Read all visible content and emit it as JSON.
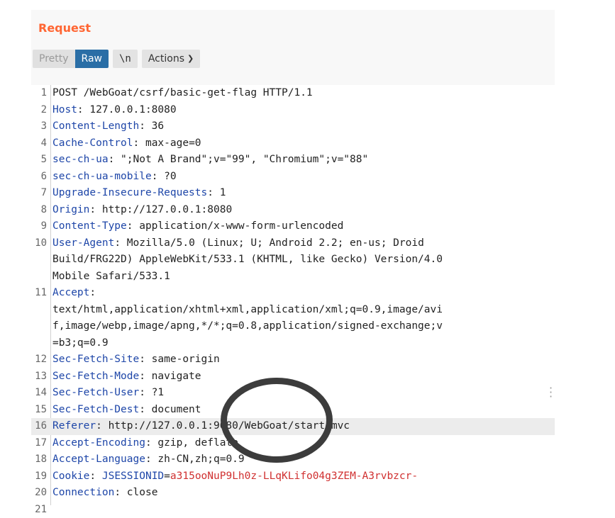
{
  "panel": {
    "title": "Request"
  },
  "toolbar": {
    "pretty_label": "Pretty",
    "raw_label": "Raw",
    "newline_label": "\\n",
    "actions_label": "Actions"
  },
  "lines": [
    {
      "n": "1",
      "segs": [
        {
          "t": "POST /WebGoat/csrf/basic-get-flag HTTP/1.1",
          "c": ""
        }
      ]
    },
    {
      "n": "2",
      "segs": [
        {
          "t": "Host",
          "c": "hk"
        },
        {
          "t": ": 127.0.0.1:8080",
          "c": ""
        }
      ]
    },
    {
      "n": "3",
      "segs": [
        {
          "t": "Content-Length",
          "c": "hk"
        },
        {
          "t": ": 36",
          "c": ""
        }
      ]
    },
    {
      "n": "4",
      "segs": [
        {
          "t": "Cache-Control",
          "c": "hk"
        },
        {
          "t": ": max-age=0",
          "c": ""
        }
      ]
    },
    {
      "n": "5",
      "segs": [
        {
          "t": "sec-ch-ua",
          "c": "hk"
        },
        {
          "t": ": \";Not A Brand\";v=\"99\", \"Chromium\";v=\"88\"",
          "c": ""
        }
      ]
    },
    {
      "n": "6",
      "segs": [
        {
          "t": "sec-ch-ua-mobile",
          "c": "hk"
        },
        {
          "t": ": ?0",
          "c": ""
        }
      ]
    },
    {
      "n": "7",
      "segs": [
        {
          "t": "Upgrade-Insecure-Requests",
          "c": "hk"
        },
        {
          "t": ": 1",
          "c": ""
        }
      ]
    },
    {
      "n": "8",
      "segs": [
        {
          "t": "Origin",
          "c": "hk"
        },
        {
          "t": ": http://127.0.0.1:8080",
          "c": ""
        }
      ]
    },
    {
      "n": "9",
      "segs": [
        {
          "t": "Content-Type",
          "c": "hk"
        },
        {
          "t": ": application/x-www-form-urlencoded",
          "c": ""
        }
      ]
    },
    {
      "n": "10",
      "segs": [
        {
          "t": "User-Agent",
          "c": "hk"
        },
        {
          "t": ": Mozilla/5.0 (Linux; U; Android 2.2; en-us; Droid",
          "c": ""
        }
      ]
    },
    {
      "n": "",
      "segs": [
        {
          "t": "Build/FRG22D) AppleWebKit/533.1 (KHTML, like Gecko) Version/4.0",
          "c": ""
        }
      ]
    },
    {
      "n": "",
      "segs": [
        {
          "t": "Mobile Safari/533.1",
          "c": ""
        }
      ]
    },
    {
      "n": "11",
      "segs": [
        {
          "t": "Accept",
          "c": "hk"
        },
        {
          "t": ":",
          "c": ""
        }
      ]
    },
    {
      "n": "",
      "segs": [
        {
          "t": "text/html,application/xhtml+xml,application/xml;q=0.9,image/avi",
          "c": ""
        }
      ]
    },
    {
      "n": "",
      "segs": [
        {
          "t": "f,image/webp,image/apng,*/*;q=0.8,application/signed-exchange;v",
          "c": ""
        }
      ]
    },
    {
      "n": "",
      "segs": [
        {
          "t": "=b3;q=0.9",
          "c": ""
        }
      ]
    },
    {
      "n": "12",
      "segs": [
        {
          "t": "Sec-Fetch-Site",
          "c": "hk"
        },
        {
          "t": ": same-origin",
          "c": ""
        }
      ]
    },
    {
      "n": "13",
      "segs": [
        {
          "t": "Sec-Fetch-Mode",
          "c": "hk"
        },
        {
          "t": ": navigate",
          "c": ""
        }
      ]
    },
    {
      "n": "14",
      "segs": [
        {
          "t": "Sec-Fetch-User",
          "c": "hk"
        },
        {
          "t": ": ?1",
          "c": ""
        }
      ]
    },
    {
      "n": "15",
      "segs": [
        {
          "t": "Sec-Fetch-Dest",
          "c": "hk"
        },
        {
          "t": ": document",
          "c": ""
        }
      ]
    },
    {
      "n": "16",
      "segs": [
        {
          "t": "Referer",
          "c": "hk"
        },
        {
          "t": ": http://127.0.0.1:9080/WebGoat/start.mvc",
          "c": ""
        }
      ],
      "highlight": true
    },
    {
      "n": "17",
      "segs": [
        {
          "t": "Accept-Encoding",
          "c": "hk"
        },
        {
          "t": ": gzip, deflate",
          "c": ""
        }
      ]
    },
    {
      "n": "18",
      "segs": [
        {
          "t": "Accept-Language",
          "c": "hk"
        },
        {
          "t": ": zh-CN,zh;q=0.9",
          "c": ""
        }
      ]
    },
    {
      "n": "19",
      "segs": [
        {
          "t": "Cookie",
          "c": "hk"
        },
        {
          "t": ": ",
          "c": ""
        },
        {
          "t": "JSESSIONID",
          "c": "hk"
        },
        {
          "t": "=",
          "c": ""
        },
        {
          "t": "a315ooNuP9Lh0z-LLqKLifo04g3ZEM-A3rvbzcr-",
          "c": "ck"
        }
      ]
    },
    {
      "n": "20",
      "segs": [
        {
          "t": "Connection",
          "c": "hk"
        },
        {
          "t": ": close",
          "c": ""
        }
      ]
    },
    {
      "n": "21",
      "segs": []
    }
  ],
  "colors": {
    "accent": "#ff6633",
    "header_key": "#1e46a8",
    "cookie_value": "#d03030",
    "raw_active": "#2a6ea6"
  }
}
